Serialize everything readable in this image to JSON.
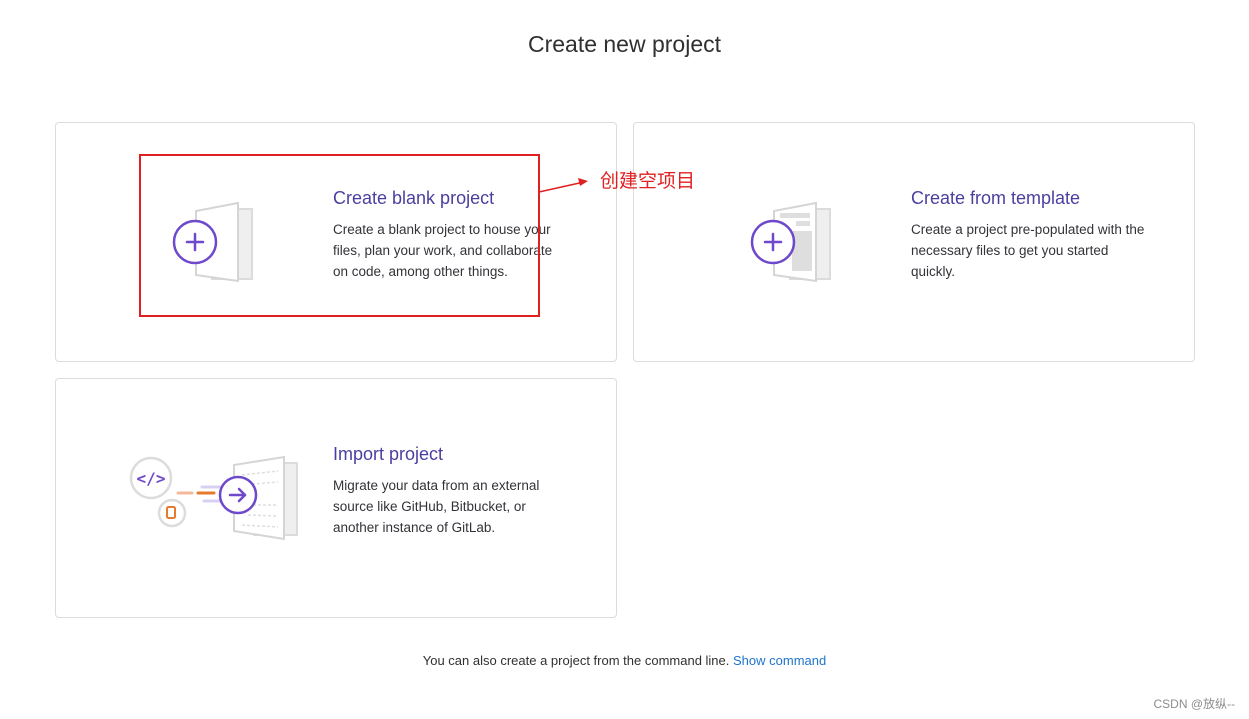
{
  "page": {
    "title": "Create new project"
  },
  "cards": [
    {
      "title": "Create blank project",
      "description": "Create a blank project to house your files, plan your work, and collaborate on code, among other things.",
      "icon": "new-page-plus-icon"
    },
    {
      "title": "Create from template",
      "description": "Create a project pre-populated with the necessary files to get you started quickly.",
      "icon": "template-page-plus-icon"
    },
    {
      "title": "Import project",
      "description": "Migrate your data from an external source like GitHub, Bitbucket, or another instance of GitLab.",
      "icon": "import-arrow-icon"
    }
  ],
  "annotation": {
    "text": "创建空项目",
    "color": "#e02020"
  },
  "footer": {
    "text": "You can also create a project from the command line.",
    "link_label": "Show command"
  },
  "watermark": "CSDN @放纵--",
  "colors": {
    "accent": "#6e49cb",
    "title": "#4a3fa0",
    "link": "#1f75cb",
    "border": "#dcdcde"
  }
}
